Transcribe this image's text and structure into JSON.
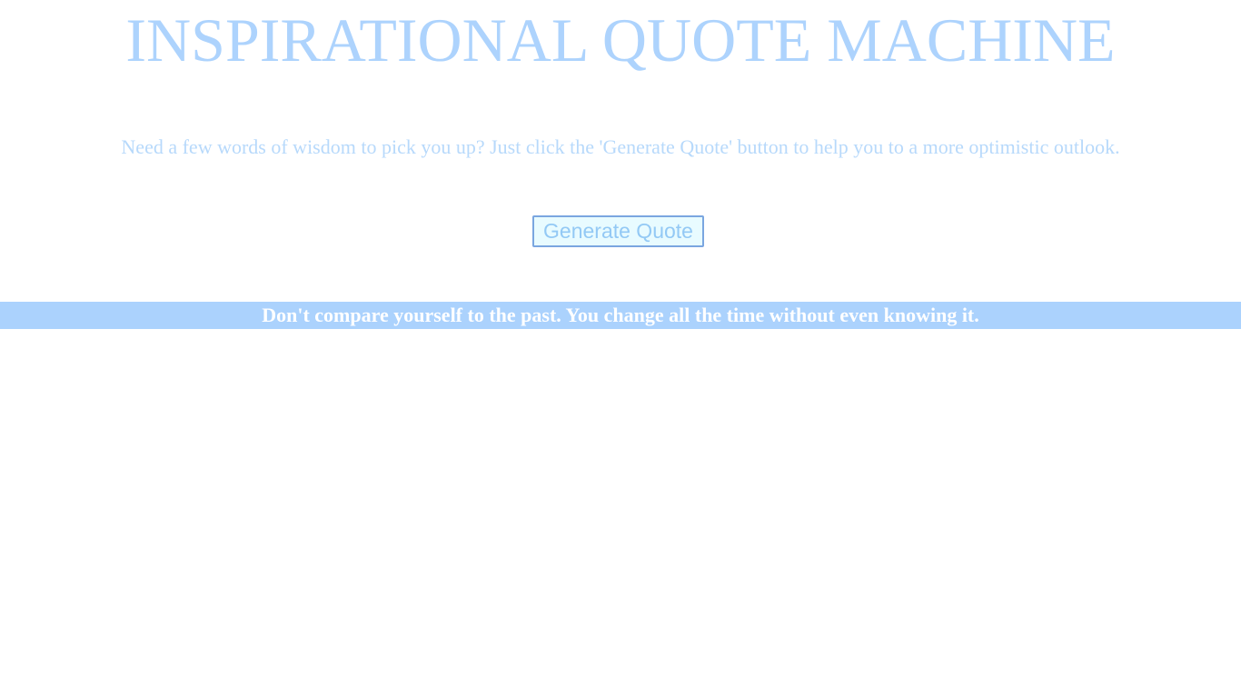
{
  "header": {
    "title": "INSPIRATIONAL QUOTE MACHINE"
  },
  "intro": {
    "text": "Need a few words of wisdom to pick you up? Just click the 'Generate Quote' button to help you to a more optimistic outlook."
  },
  "controls": {
    "generate_label": "Generate Quote"
  },
  "quote": {
    "text": "Don't compare yourself to the past. You change all the time without even knowing it."
  },
  "colors": {
    "title": "#add3fd",
    "intro": "#b7d9fb",
    "button_bg": "#e8fbff",
    "button_border": "#7aa6e0",
    "quote_bar": "#abd2fd",
    "quote_text": "#ffffff"
  }
}
